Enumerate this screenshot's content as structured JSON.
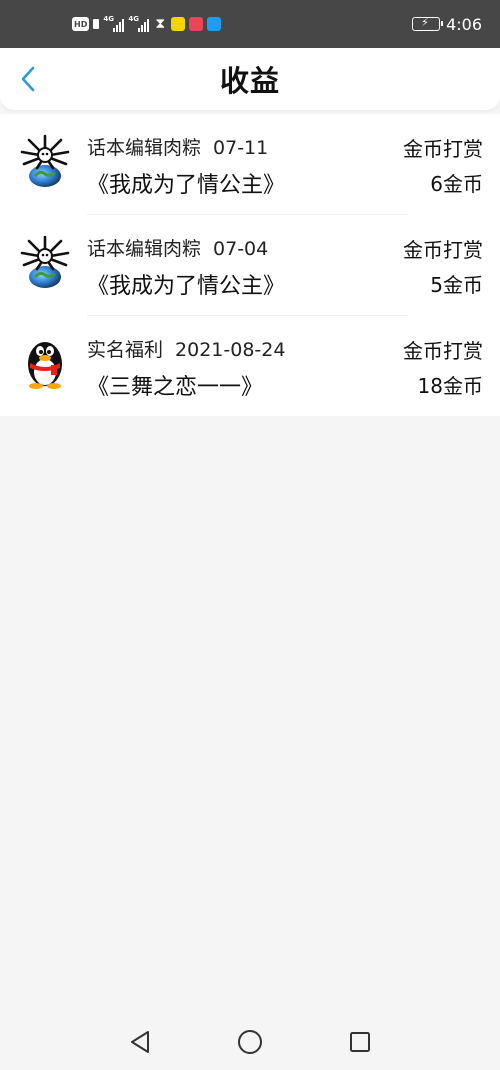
{
  "status_bar": {
    "hd_label": "HD",
    "signal1_label": "4G",
    "signal2_label": "4G",
    "time": "4:06",
    "icons": [
      "hd-icon",
      "sim-icon",
      "signal-icon",
      "signal-icon",
      "hourglass-icon",
      "chat-app-icon",
      "book-app-icon",
      "search-app-icon",
      "battery-charging-icon"
    ]
  },
  "header": {
    "title": "收益",
    "back_icon": "chevron-left-icon",
    "accent_color": "#2a9bd8"
  },
  "records": [
    {
      "avatar": "spider-globe-avatar",
      "source": "话本编辑肉粽",
      "date": "07-11",
      "book": "《我成为了情公主》",
      "kind": "金币打赏",
      "amount": "6金币"
    },
    {
      "avatar": "spider-globe-avatar",
      "source": "话本编辑肉粽",
      "date": "07-04",
      "book": "《我成为了情公主》",
      "kind": "金币打赏",
      "amount": "5金币"
    },
    {
      "avatar": "penguin-avatar",
      "source": "实名福利",
      "date": "2021-08-24",
      "book": "《三舞之恋一一》",
      "kind": "金币打赏",
      "amount": "18金币"
    }
  ],
  "nav_bar": {
    "icons": [
      "back-triangle-icon",
      "home-circle-icon",
      "recents-square-icon"
    ]
  }
}
